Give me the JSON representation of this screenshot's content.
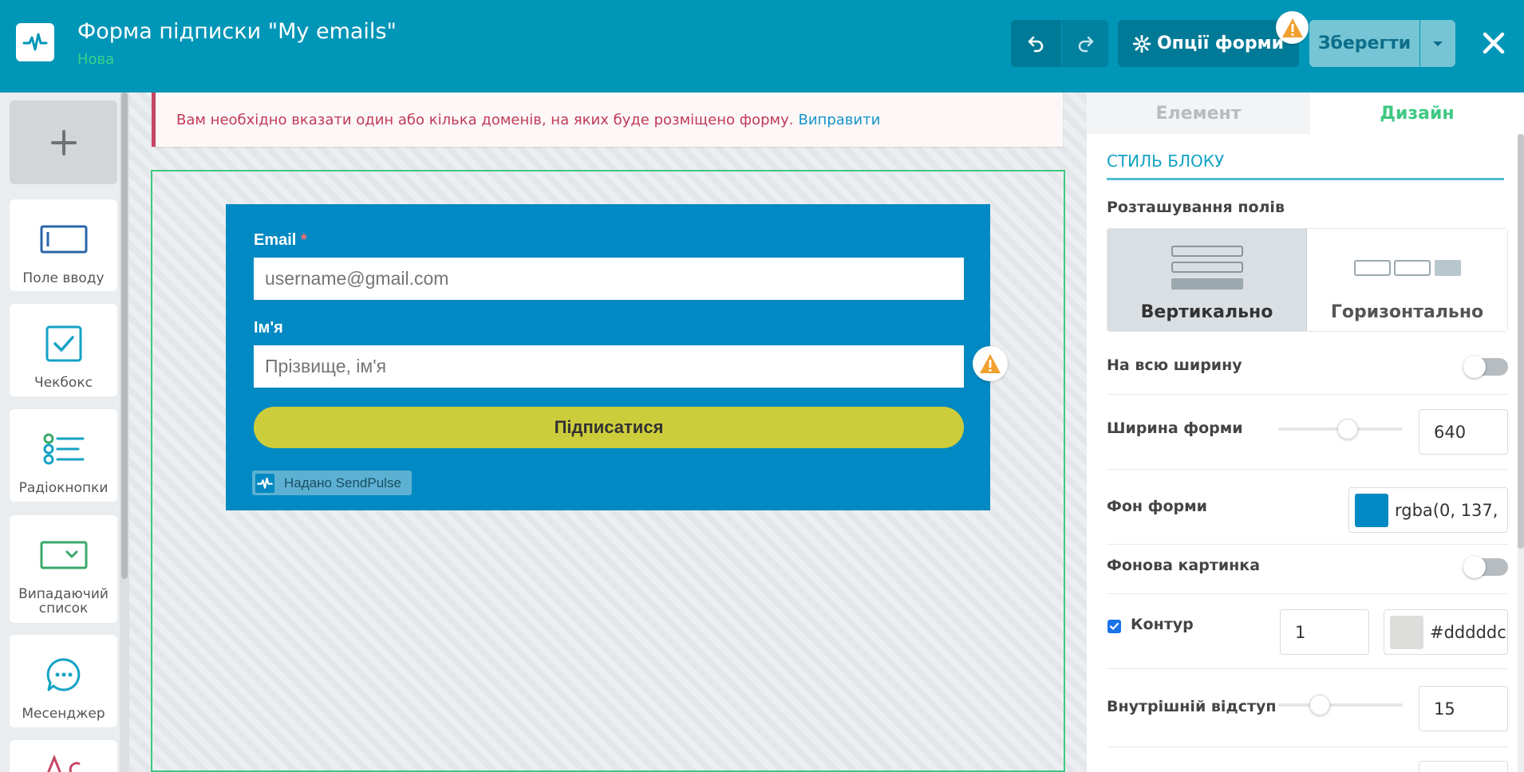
{
  "header": {
    "title": "Форма підписки \"My emails\"",
    "status": "Нова",
    "options_label": "Опції форми",
    "save_label": "Зберегти"
  },
  "toolbar": {
    "add_icon": "plus-icon",
    "tools": [
      {
        "label": "Поле вводу",
        "icon": "input-field-icon"
      },
      {
        "label": "Чекбокс",
        "icon": "checkbox-icon"
      },
      {
        "label": "Радіокнопки",
        "icon": "radio-list-icon"
      },
      {
        "label": "Випадаючий список",
        "icon": "dropdown-icon"
      },
      {
        "label": "Месенджер",
        "icon": "messenger-icon"
      }
    ]
  },
  "alert": {
    "message": "Вам необхідно вказати один або кілька доменів, на яких буде розміщено форму.",
    "link": "Виправити"
  },
  "form": {
    "background": "#0089c2",
    "email_label": "Email",
    "required_mark": "*",
    "email_placeholder": "username@gmail.com",
    "name_label": "Ім'я",
    "name_placeholder": "Прізвище, ім'я",
    "submit_label": "Підписатися",
    "powered_by": "Надано SendPulse"
  },
  "panel": {
    "tabs": [
      "Елемент",
      "Дизайн"
    ],
    "active_tab": "Дизайн",
    "section_title": "СТИЛЬ БЛОКУ",
    "fields_layout_label": "Розташування полів",
    "layout_options": [
      "Вертикально",
      "Горизонтально"
    ],
    "selected_layout": "Вертикально",
    "full_width_label": "На всю ширину",
    "full_width": false,
    "form_width_label": "Ширина форми",
    "form_width": "640",
    "form_width_level": 0.57,
    "form_bg_label": "Фон форми",
    "form_bg_value": "rgba(0, 137,",
    "bg_image_label": "Фонова картинка",
    "bg_image": false,
    "border_label": "Контур",
    "border_checked": true,
    "border_width": "1",
    "border_color": "#dddddc",
    "padding_label": "Внутрішній відступ",
    "padding": "15",
    "padding_level": 0.3
  },
  "colors": {
    "header": "#0096b8",
    "accent_green": "#3ec983",
    "alert": "#c13a59",
    "warning": "#f0a030"
  }
}
